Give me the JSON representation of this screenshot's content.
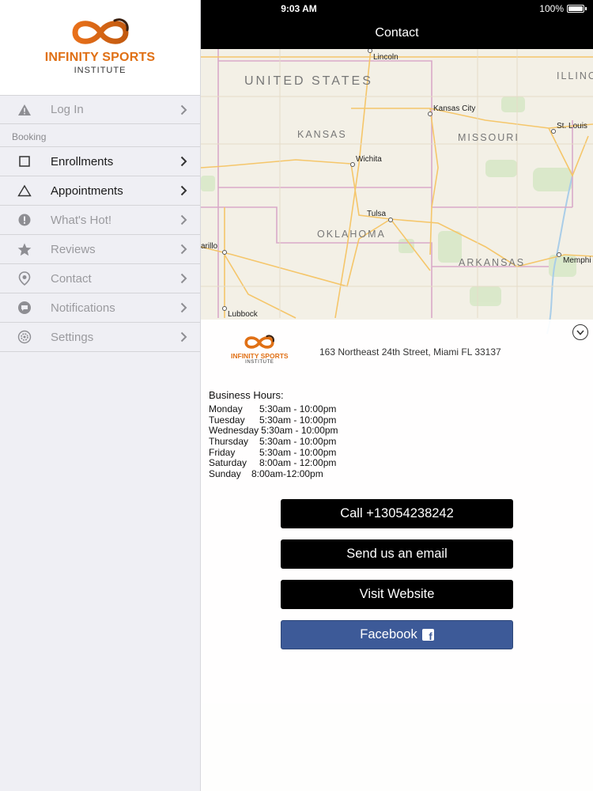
{
  "status_bar": {
    "time": "9:03 AM",
    "battery": "100%"
  },
  "nav": {
    "title": "Contact"
  },
  "brand": {
    "name": "INFINITY SPORTS",
    "sub": "INSTITUTE"
  },
  "sidebar": {
    "login_label": "Log In",
    "section_label": "Booking",
    "items": [
      {
        "label": "Enrollments",
        "icon": "square-icon",
        "active": true
      },
      {
        "label": "Appointments",
        "icon": "triangle-icon",
        "active": true
      },
      {
        "label": "What's Hot!",
        "icon": "exclamation-icon",
        "active": false
      },
      {
        "label": "Reviews",
        "icon": "star-icon",
        "active": false
      },
      {
        "label": "Contact",
        "icon": "map-pin-icon",
        "active": false
      },
      {
        "label": "Notifications",
        "icon": "chat-bubble-icon",
        "active": false
      },
      {
        "label": "Settings",
        "icon": "gear-icon",
        "active": false
      }
    ]
  },
  "map": {
    "country": "UNITED STATES",
    "states": [
      "KANSAS",
      "MISSOURI",
      "OKLAHOMA",
      "ARKANSAS",
      "ILLINO"
    ],
    "cities": [
      "Lincoln",
      "Kansas City",
      "St. Louis",
      "Wichita",
      "Tulsa",
      "arillo",
      "Memphi",
      "Lubbock"
    ]
  },
  "contact": {
    "address": "163 Northeast 24th Street, Miami FL 33137",
    "hours_title": "Business Hours:",
    "hours": [
      {
        "day": "Monday",
        "time": "5:30am - 10:00pm"
      },
      {
        "day": "Tuesday",
        "time": "5:30am - 10:00pm"
      },
      {
        "day": "Wednesday",
        "time": "5:30am - 10:00pm"
      },
      {
        "day": "Thursday",
        "time": "5:30am - 10:00pm"
      },
      {
        "day": "Friday",
        "time": "5:30am - 10:00pm"
      },
      {
        "day": "Saturday",
        "time": "8:00am - 12:00pm"
      },
      {
        "day": "Sunday",
        "time": "8:00am-12:00pm"
      }
    ],
    "buttons": {
      "call": "Call +13054238242",
      "email": "Send us an email",
      "website": "Visit Website",
      "facebook": "Facebook"
    }
  },
  "colors": {
    "brand_orange": "#e07015",
    "facebook_blue": "#3d5a98",
    "nav_black": "#000000"
  }
}
